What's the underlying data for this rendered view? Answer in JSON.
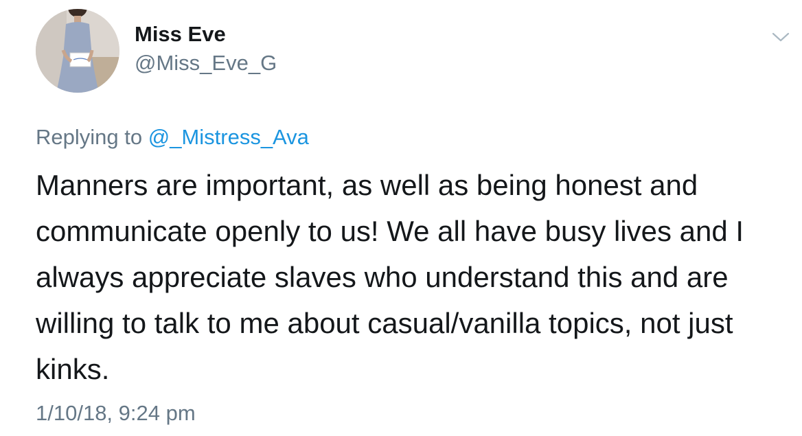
{
  "author": {
    "display_name": "Miss Eve",
    "handle": "@Miss_Eve_G",
    "avatar_icon": "profile-photo-avatar"
  },
  "menu": {
    "icon": "chevron-down-icon"
  },
  "reply": {
    "prefix": "Replying to",
    "mention": "@_Mistress_Ava"
  },
  "tweet": {
    "lines": [
      "Manners are important, as well as being honest and",
      "communicate openly to us! We all have busy lives and I",
      "always appreciate slaves who understand this and are",
      "willing to talk to me about casual/vanilla topics, not just",
      "kinks."
    ],
    "timestamp": "1/10/18, 9:24 pm"
  },
  "colors": {
    "text": "#14171a",
    "secondary": "#657786",
    "link": "#1b95e0"
  }
}
